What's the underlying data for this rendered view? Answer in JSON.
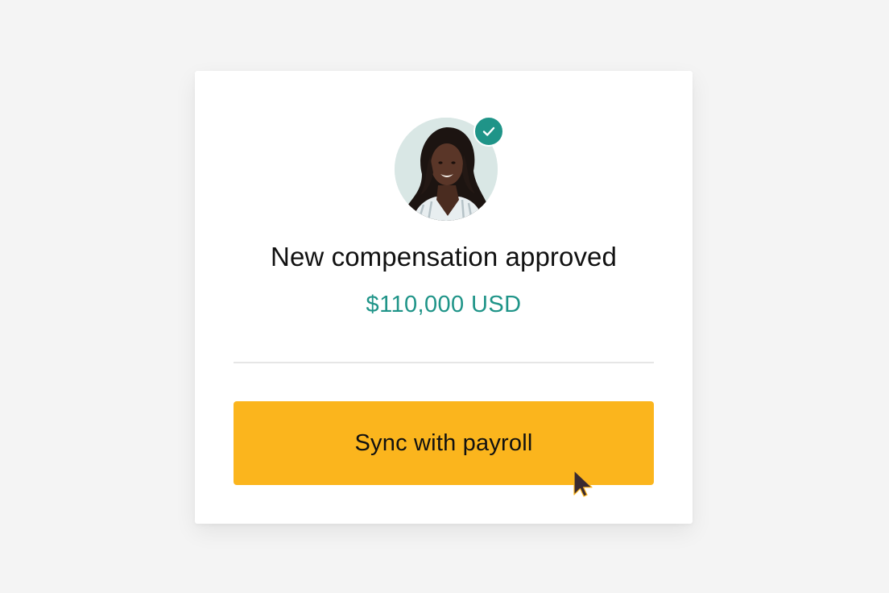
{
  "card": {
    "title": "New compensation approved",
    "amount": "$110,000 USD",
    "button_label": "Sync with payroll"
  },
  "icons": {
    "avatar": "person-avatar",
    "badge": "check-icon",
    "pointer": "mouse-cursor-icon"
  },
  "colors": {
    "background": "#f4f4f4",
    "card": "#ffffff",
    "accent": "#1f9488",
    "button": "#fbb51d",
    "text": "#111111"
  }
}
